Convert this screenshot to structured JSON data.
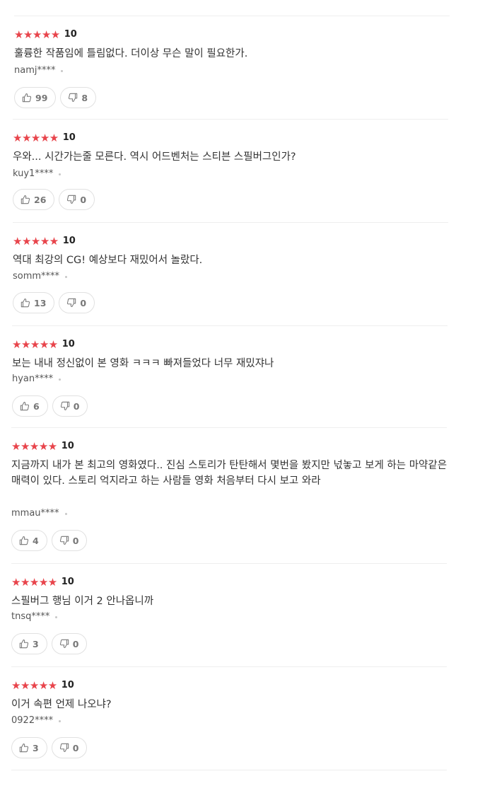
{
  "reviews": [
    {
      "stars": "★★★★★",
      "score": "10",
      "text": "훌륭한 작품임에 틀림없다. 더이상 무슨 말이 필요한가.",
      "author": "namj****",
      "likes": "99",
      "dislikes": "8"
    },
    {
      "stars": "★★★★★",
      "score": "10",
      "text": "우와... 시간가는줄 모른다. 역시 어드벤처는 스티븐 스필버그인가?",
      "author": "kuy1****",
      "likes": "26",
      "dislikes": "0"
    },
    {
      "stars": "★★★★★",
      "score": "10",
      "text": "역대 최강의 CG! 예상보다 재밌어서 놀랐다.",
      "author": "somm****",
      "likes": "13",
      "dislikes": "0"
    },
    {
      "stars": "★★★★★",
      "score": "10",
      "text": "보는 내내 정신없이 본 영화 ㅋㅋㅋ 빠져들었다 너무 재밌쟈나",
      "author": "hyan****",
      "likes": "6",
      "dislikes": "0"
    },
    {
      "stars": "★★★★★",
      "score": "10",
      "text": "지금까지 내가 본 최고의 영화였다.. 진심 스토리가 탄탄해서 몇번을 봤지만 넋놓고 보게 하는 마약같은 매력이 있다. 스토리 억지라고 하는 사람들 영화 처음부터 다시 보고 와라",
      "author": "mmau****",
      "likes": "4",
      "dislikes": "0"
    },
    {
      "stars": "★★★★★",
      "score": "10",
      "text": "스필버그 행님 이거 2 안나옵니까",
      "author": "tnsq****",
      "likes": "3",
      "dislikes": "0"
    },
    {
      "stars": "★★★★★",
      "score": "10",
      "text": "이거 속편 언제 나오냐?",
      "author": "0922****",
      "likes": "3",
      "dislikes": "0"
    }
  ]
}
